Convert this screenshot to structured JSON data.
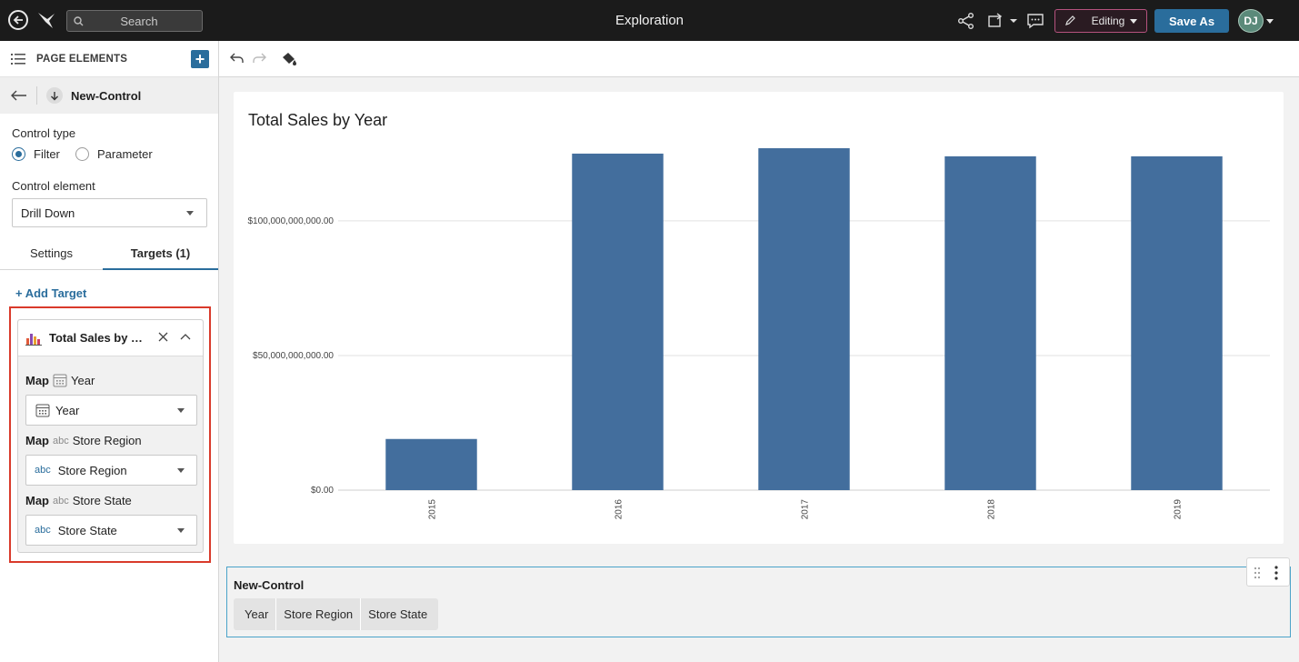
{
  "topbar": {
    "search_placeholder": "Search",
    "title": "Exploration",
    "mode_label": "Editing",
    "save_as_label": "Save As",
    "avatar_initials": "DJ"
  },
  "left_panel": {
    "header_title": "PAGE ELEMENTS",
    "element_name": "New-Control",
    "control_type_label": "Control type",
    "control_type_options": [
      "Filter",
      "Parameter"
    ],
    "control_type_selected": "Filter",
    "control_element_label": "Control element",
    "control_element_value": "Drill Down",
    "tabs": [
      "Settings",
      "Targets (1)"
    ],
    "active_tab": "Targets (1)",
    "add_target_label": "+ Add Target",
    "target": {
      "title": "Total Sales by Year",
      "maps": [
        {
          "map_label": "Map",
          "type_tag": "",
          "field": "Year",
          "value": "Year",
          "icon": "calendar-icon"
        },
        {
          "map_label": "Map",
          "type_tag": "abc",
          "field": "Store Region",
          "value": "Store Region",
          "icon": "abc"
        },
        {
          "map_label": "Map",
          "type_tag": "abc",
          "field": "Store State",
          "value": "Store State",
          "icon": "abc"
        }
      ]
    }
  },
  "control": {
    "title": "New-Control",
    "chips": [
      "Year",
      "Store Region",
      "Store State"
    ]
  },
  "chart_data": {
    "type": "bar",
    "title": "Total Sales by Year",
    "categories": [
      "2015",
      "2016",
      "2017",
      "2018",
      "2019"
    ],
    "values": [
      19000000000,
      125000000000,
      127000000000,
      124000000000,
      124000000000
    ],
    "ylim": [
      0,
      127000000000
    ],
    "yticks": [
      0,
      50000000000,
      100000000000
    ],
    "ytick_labels": [
      "$0.00",
      "$50,000,000,000.00",
      "$100,000,000,000.00"
    ],
    "bar_color": "#436e9d",
    "grid": true
  },
  "colors": {
    "accent": "#2a6d9c",
    "highlight": "#d93a2b",
    "topbar_bg": "#1b1b1b"
  }
}
